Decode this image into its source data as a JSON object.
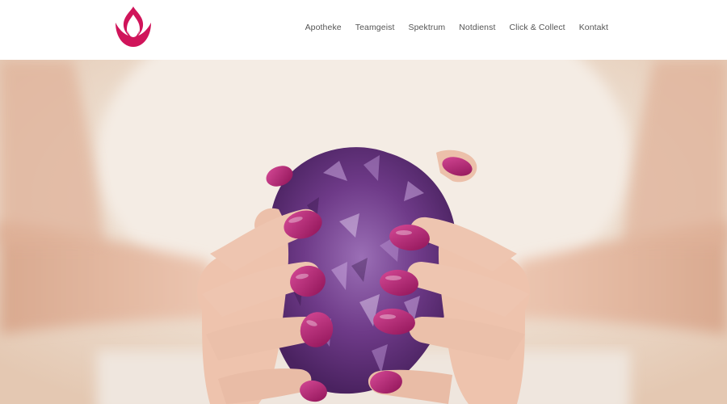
{
  "brand": {
    "logo_icon": "lotus-drop-icon",
    "color": "#d0145a"
  },
  "nav": {
    "items": [
      {
        "label": "Apotheke"
      },
      {
        "label": "Teamgeist"
      },
      {
        "label": "Spektrum"
      },
      {
        "label": "Notdienst"
      },
      {
        "label": "Click & Collect"
      },
      {
        "label": "Kontakt"
      }
    ]
  },
  "hero": {
    "image_subject": "hands-holding-amethyst-crystal",
    "colors": {
      "background": "#eee1d3",
      "skin": "#e8b8a0",
      "crystal": "#6e3a88",
      "nail": "#b0226e"
    }
  }
}
